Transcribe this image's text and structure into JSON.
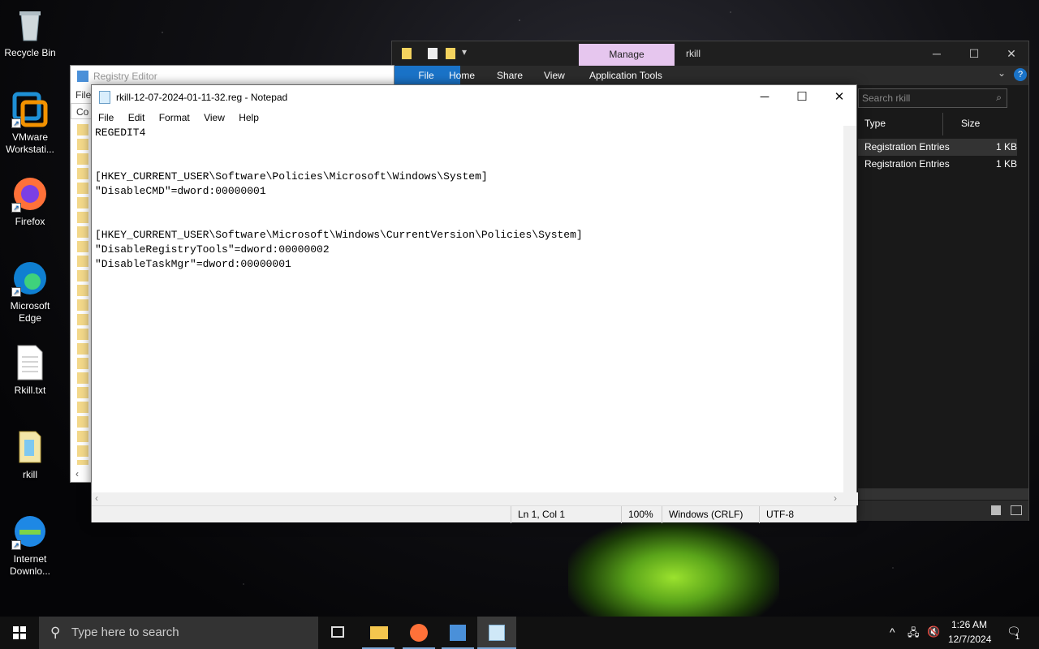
{
  "desktop": {
    "icons": [
      {
        "label": "Recycle Bin"
      },
      {
        "label": "VMware Workstati..."
      },
      {
        "label": "Firefox"
      },
      {
        "label": "Microsoft Edge"
      },
      {
        "label": "Rkill.txt"
      },
      {
        "label": "rkill"
      },
      {
        "label": "Internet Downlo..."
      }
    ]
  },
  "explorer": {
    "manage": "Manage",
    "title": "rkill",
    "ribbon": {
      "file": "File",
      "home": "Home",
      "share": "Share",
      "view": "View",
      "tools": "Application Tools"
    },
    "search_placeholder": "Search rkill",
    "columns": {
      "type": "Type",
      "size": "Size"
    },
    "rows": [
      {
        "type": "Registration Entries",
        "size": "1 KB"
      },
      {
        "type": "Registration Entries",
        "size": "1 KB"
      }
    ]
  },
  "regedit": {
    "title": "Registry Editor",
    "menu_file": "File",
    "address": "Co"
  },
  "notepad": {
    "title": "rkill-12-07-2024-01-11-32.reg - Notepad",
    "menu": [
      "File",
      "Edit",
      "Format",
      "View",
      "Help"
    ],
    "content": "REGEDIT4\n\n\n[HKEY_CURRENT_USER\\Software\\Policies\\Microsoft\\Windows\\System]\n\"DisableCMD\"=dword:00000001\n\n\n[HKEY_CURRENT_USER\\Software\\Microsoft\\Windows\\CurrentVersion\\Policies\\System]\n\"DisableRegistryTools\"=dword:00000002\n\"DisableTaskMgr\"=dword:00000001",
    "status": {
      "position": "Ln 1, Col 1",
      "zoom": "100%",
      "line_ending": "Windows (CRLF)",
      "encoding": "UTF-8"
    }
  },
  "taskbar": {
    "search_placeholder": "Type here to search",
    "time": "1:26 AM",
    "date": "12/7/2024",
    "notification_count": "1"
  }
}
